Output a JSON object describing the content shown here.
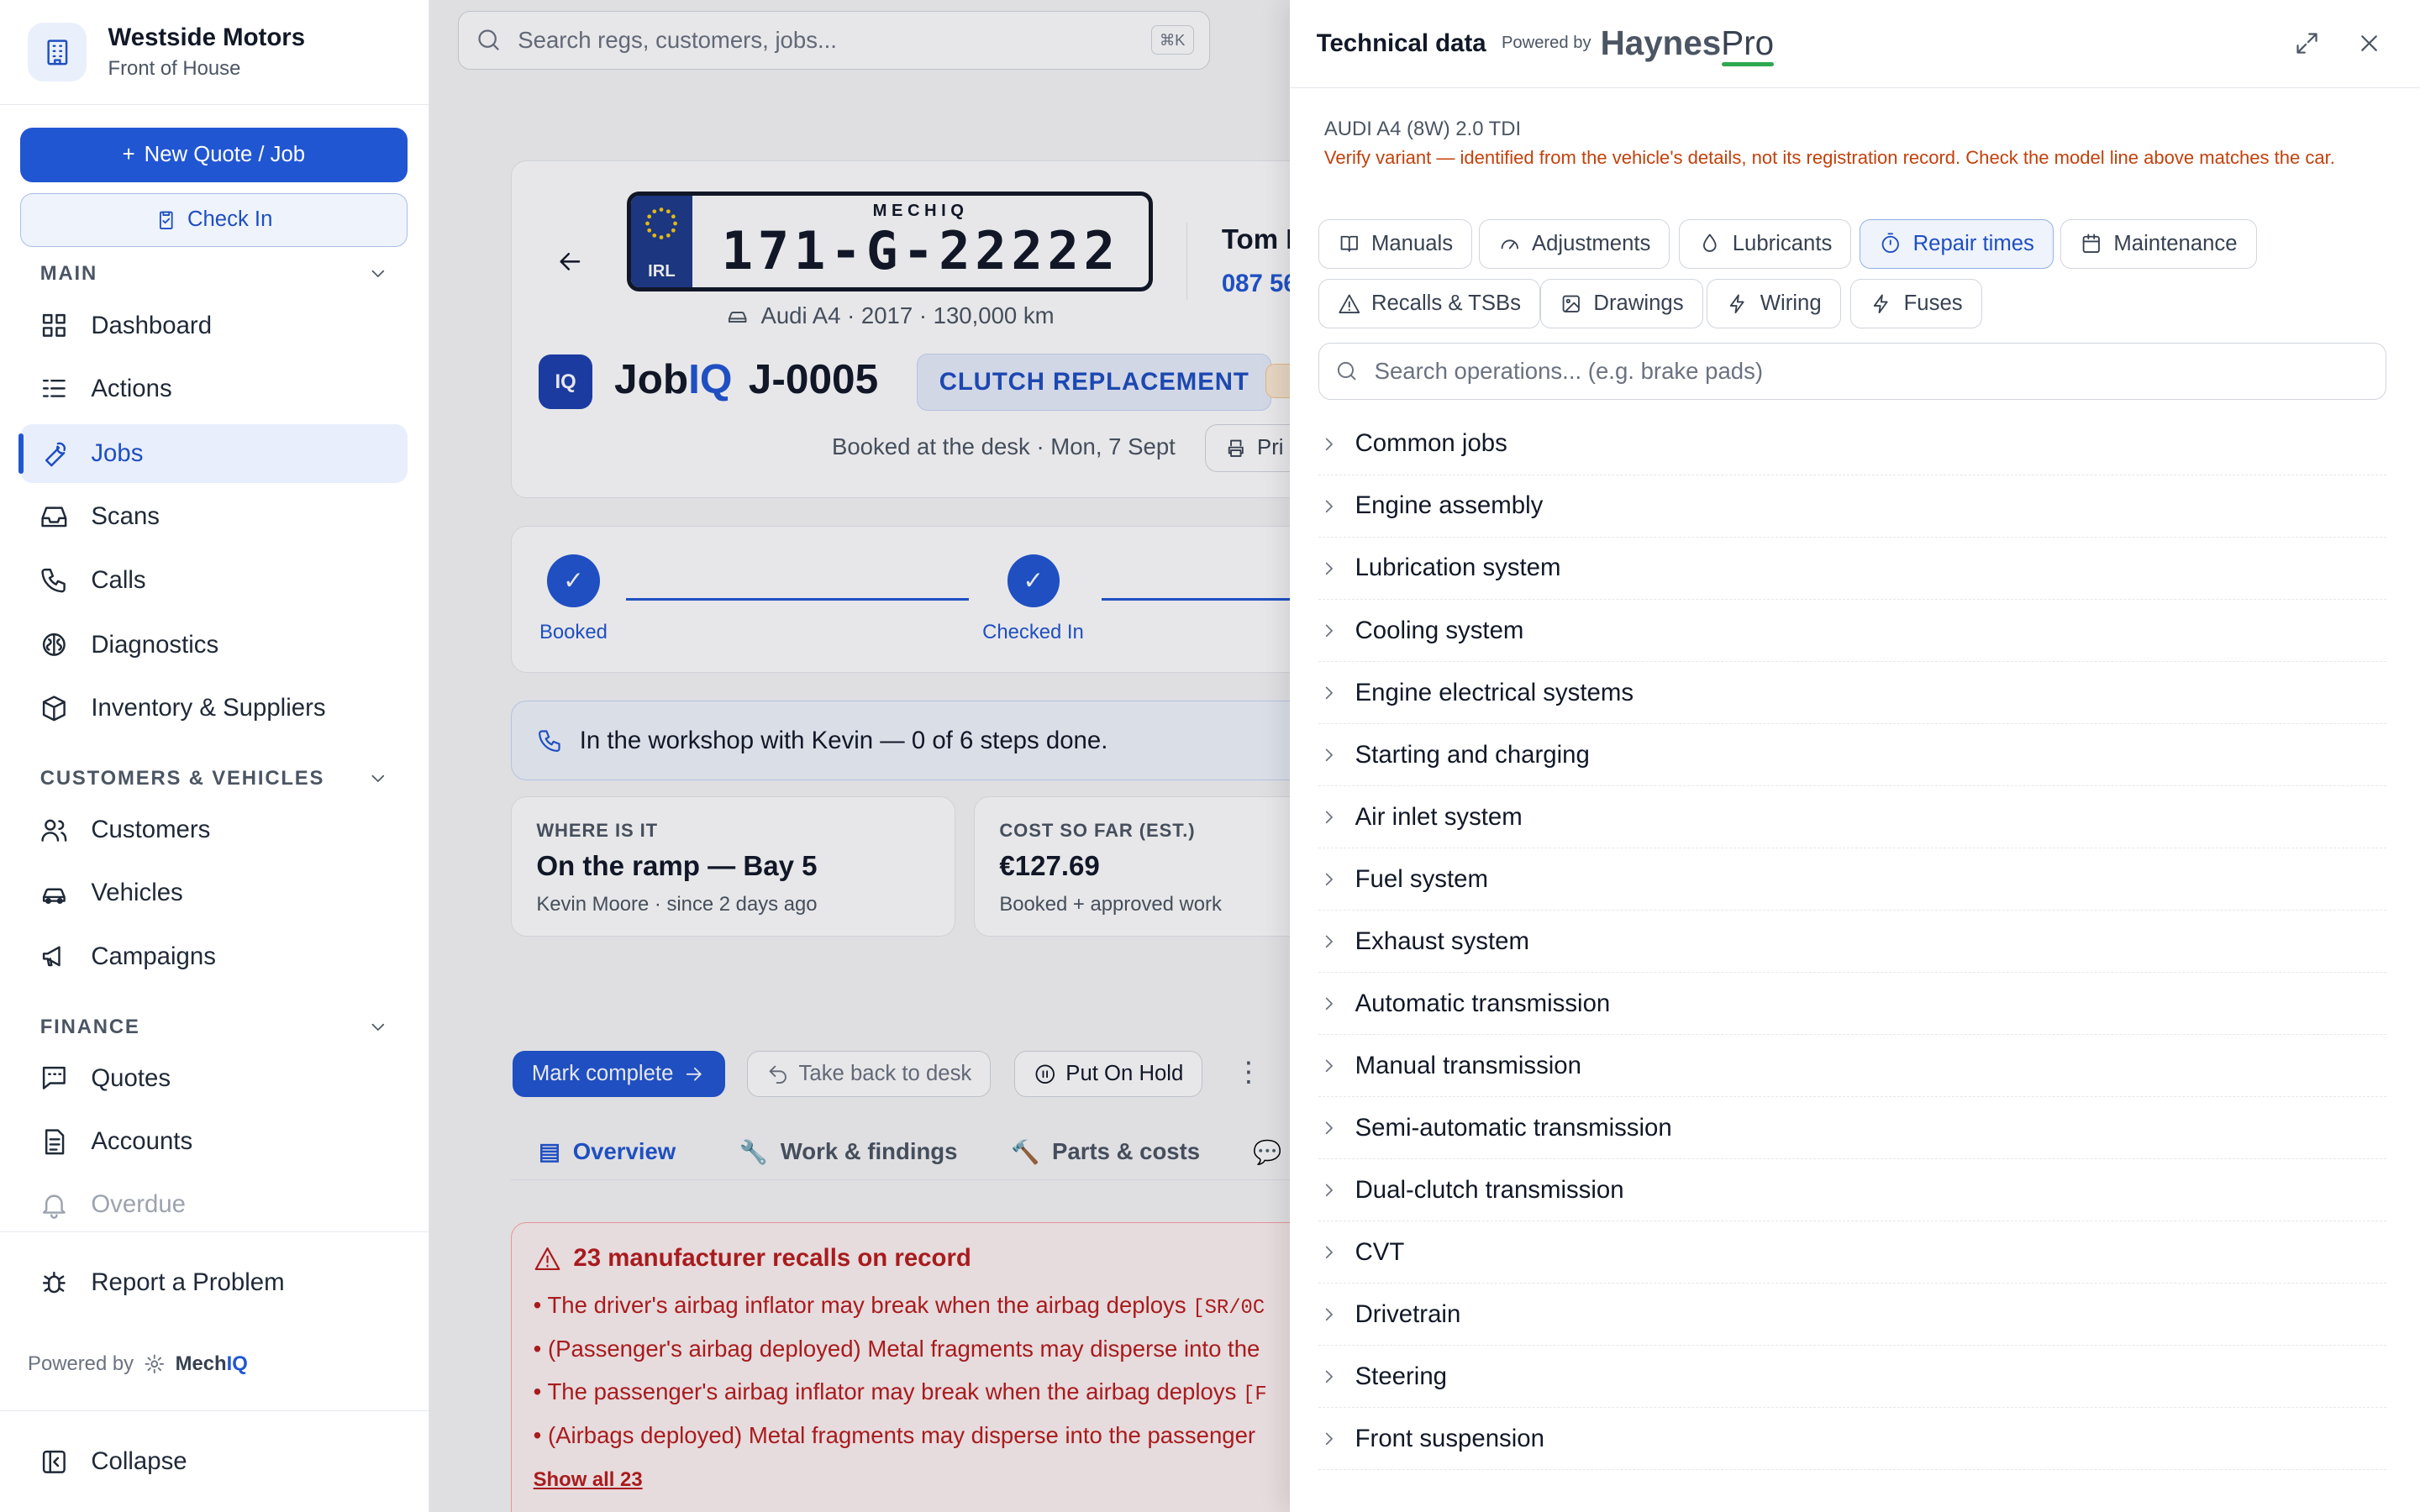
{
  "brand": {
    "name": "Westside Motors",
    "sub": "Front of House"
  },
  "sidebar": {
    "new_quote": "New Quote / Job",
    "check_in": "Check In",
    "sections": {
      "main": "MAIN",
      "customers": "CUSTOMERS & VEHICLES",
      "finance": "FINANCE"
    },
    "main_items": [
      {
        "label": "Dashboard",
        "icon": "dashboard-icon"
      },
      {
        "label": "Actions",
        "icon": "list-icon"
      },
      {
        "label": "Jobs",
        "icon": "wrench-icon",
        "active": true
      },
      {
        "label": "Scans",
        "icon": "inbox-icon"
      },
      {
        "label": "Calls",
        "icon": "phone-icon"
      },
      {
        "label": "Diagnostics",
        "icon": "brain-icon"
      },
      {
        "label": "Inventory & Suppliers",
        "icon": "box-icon"
      }
    ],
    "customer_items": [
      {
        "label": "Customers",
        "icon": "users-icon"
      },
      {
        "label": "Vehicles",
        "icon": "car-icon"
      },
      {
        "label": "Campaigns",
        "icon": "megaphone-icon"
      }
    ],
    "finance_items": [
      {
        "label": "Quotes",
        "icon": "message-icon"
      },
      {
        "label": "Accounts",
        "icon": "document-icon"
      },
      {
        "label": "Overdue",
        "icon": "bell-icon"
      }
    ],
    "report": "Report a Problem",
    "powered": "Powered by",
    "powered_brand_a": "Mech",
    "powered_brand_b": "IQ",
    "collapse": "Collapse"
  },
  "topbar": {
    "search_placeholder": "Search regs, customers, jobs...",
    "shortcut": "⌘K"
  },
  "job": {
    "plate_top": "MECHIQ",
    "plate_country": "IRL",
    "plate_reg": "171-G-22222",
    "vehicle": "Audi A4 · 2017 · 130,000 km",
    "customer_name": "Tom F",
    "customer_phone": "087 56",
    "iq_badge": "IQ",
    "jobiq_a": "Job",
    "jobiq_b": "IQ",
    "job_id": "J-0005",
    "job_type": "CLUTCH REPLACEMENT",
    "booked": "Booked at the desk · Mon, 7 Sept",
    "print": "Pri",
    "steps": [
      "Booked",
      "Checked In"
    ],
    "workshop_msg": "In the workshop with Kevin — 0 of 6 steps done.",
    "where_label": "WHERE IS IT",
    "where_value": "On the ramp — Bay 5",
    "where_sub": "Kevin Moore · since 2 days ago",
    "cost_label": "COST SO FAR (EST.)",
    "cost_value": "€127.69",
    "cost_sub": "Booked + approved work",
    "actions": {
      "complete": "Mark complete",
      "back": "Take back to desk",
      "hold": "Put On Hold"
    },
    "tabs": [
      "Overview",
      "Work & findings",
      "Parts & costs"
    ],
    "recalls_title": "23 manufacturer recalls on record",
    "recalls": [
      "The driver's airbag inflator may break when the airbag deploys",
      "(Passenger's airbag deployed) Metal fragments may disperse into the",
      "The passenger's airbag inflator may break when the airbag deploys",
      "(Airbags deployed) Metal fragments may disperse into the passenger"
    ],
    "recall_code_1": "[SR/0C",
    "recall_code_3": "[F",
    "show_all": "Show all 23"
  },
  "panel": {
    "title": "Technical data",
    "powered": "Powered by",
    "haynes_a": "Haynes",
    "haynes_b": "Pro",
    "vehicle_line": "AUDI A4 (8W) 2.0 TDI",
    "warning": "Verify variant — identified from the vehicle's details, not its registration record. Check the model line above matches the car.",
    "tabs": [
      {
        "label": "Manuals",
        "icon": "book-icon"
      },
      {
        "label": "Adjustments",
        "icon": "gauge-icon"
      },
      {
        "label": "Lubricants",
        "icon": "droplet-icon"
      },
      {
        "label": "Repair times",
        "icon": "timer-icon",
        "selected": true
      },
      {
        "label": "Maintenance",
        "icon": "calendar-icon"
      },
      {
        "label": "Recalls & TSBs",
        "icon": "warning-icon"
      },
      {
        "label": "Drawings",
        "icon": "image-icon"
      },
      {
        "label": "Wiring",
        "icon": "bolt-icon"
      },
      {
        "label": "Fuses",
        "icon": "bolt-icon"
      }
    ],
    "search_placeholder": "Search operations... (e.g. brake pads)",
    "operations": [
      "Common jobs",
      "Engine assembly",
      "Lubrication system",
      "Cooling system",
      "Engine electrical systems",
      "Starting and charging",
      "Air inlet system",
      "Fuel system",
      "Exhaust system",
      "Automatic transmission",
      "Manual transmission",
      "Semi-automatic transmission",
      "Dual-clutch transmission",
      "CVT",
      "Drivetrain",
      "Steering",
      "Front suspension"
    ]
  },
  "colors": {
    "accent": "#2156d3",
    "warning": "#b45309",
    "danger": "#b91c1c",
    "haynes_green": "#2fa84f"
  }
}
